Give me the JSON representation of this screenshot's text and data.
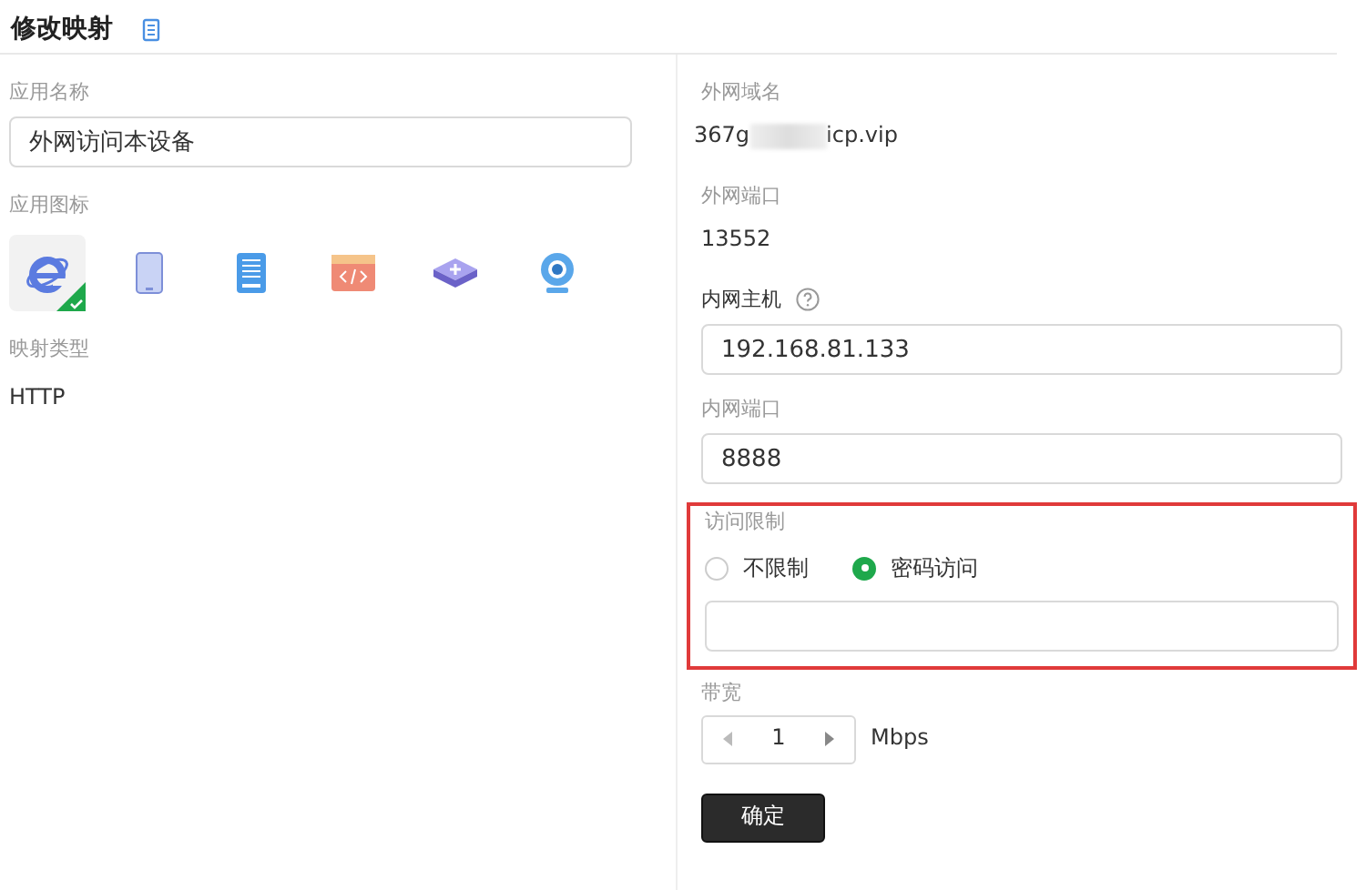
{
  "title": "修改映射",
  "left": {
    "app_name": {
      "label": "应用名称",
      "value": "外网访问本设备"
    },
    "icons": {
      "label": "应用图标",
      "items": [
        {
          "kind": "browser",
          "selected": true
        },
        {
          "kind": "tablet",
          "selected": false
        },
        {
          "kind": "server",
          "selected": false
        },
        {
          "kind": "code",
          "selected": false
        },
        {
          "kind": "router",
          "selected": false
        },
        {
          "kind": "webcam",
          "selected": false
        }
      ]
    },
    "mapping_type": {
      "label": "映射类型",
      "value": "HTTP"
    }
  },
  "right": {
    "domain": {
      "label": "外网域名",
      "start": "367g",
      "end": "icp.vip"
    },
    "port": {
      "label": "外网端口",
      "value": "13552"
    },
    "host": {
      "label": "内网主机",
      "value": "192.168.81.133"
    },
    "inner_port": {
      "label": "内网端口",
      "value": "8888"
    },
    "access": {
      "label": "访问限制",
      "options": [
        {
          "label": "不限制",
          "selected": false
        },
        {
          "label": "密码访问",
          "selected": true
        }
      ]
    },
    "bandwidth": {
      "label": "带宽",
      "value": "1",
      "unit": "Mbps"
    },
    "confirm": "确定"
  }
}
